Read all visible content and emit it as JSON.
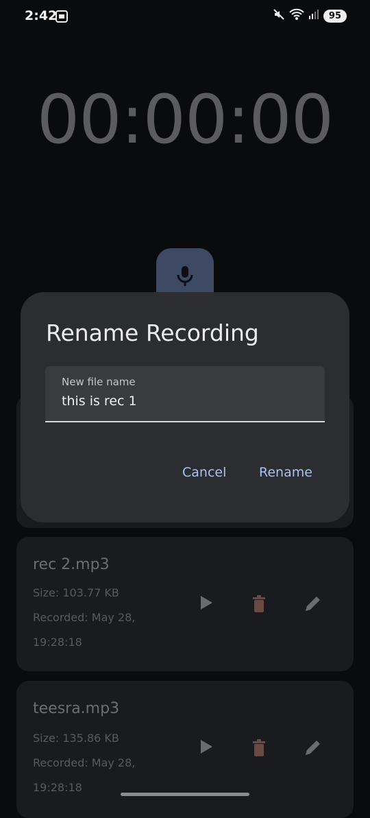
{
  "status": {
    "time": "2:42",
    "battery": "95"
  },
  "timer": "00:00:00",
  "dialog": {
    "title": "Rename Recording",
    "field_label": "New file name",
    "field_value": "this is rec 1",
    "cancel": "Cancel",
    "rename": "Rename"
  },
  "recordings": [
    {
      "name": "rec 2.mp3",
      "size": "Size: 103.77 KB",
      "recorded": "Recorded: May 28,",
      "time": "19:28:18"
    },
    {
      "name": "teesra.mp3",
      "size": "Size: 135.86 KB",
      "recorded": "Recorded: May 28,",
      "time": "19:28:18"
    }
  ],
  "colors": {
    "accent": "#a9c1f0",
    "mic_button": "#3e4964",
    "delete": "#6b4a44"
  }
}
